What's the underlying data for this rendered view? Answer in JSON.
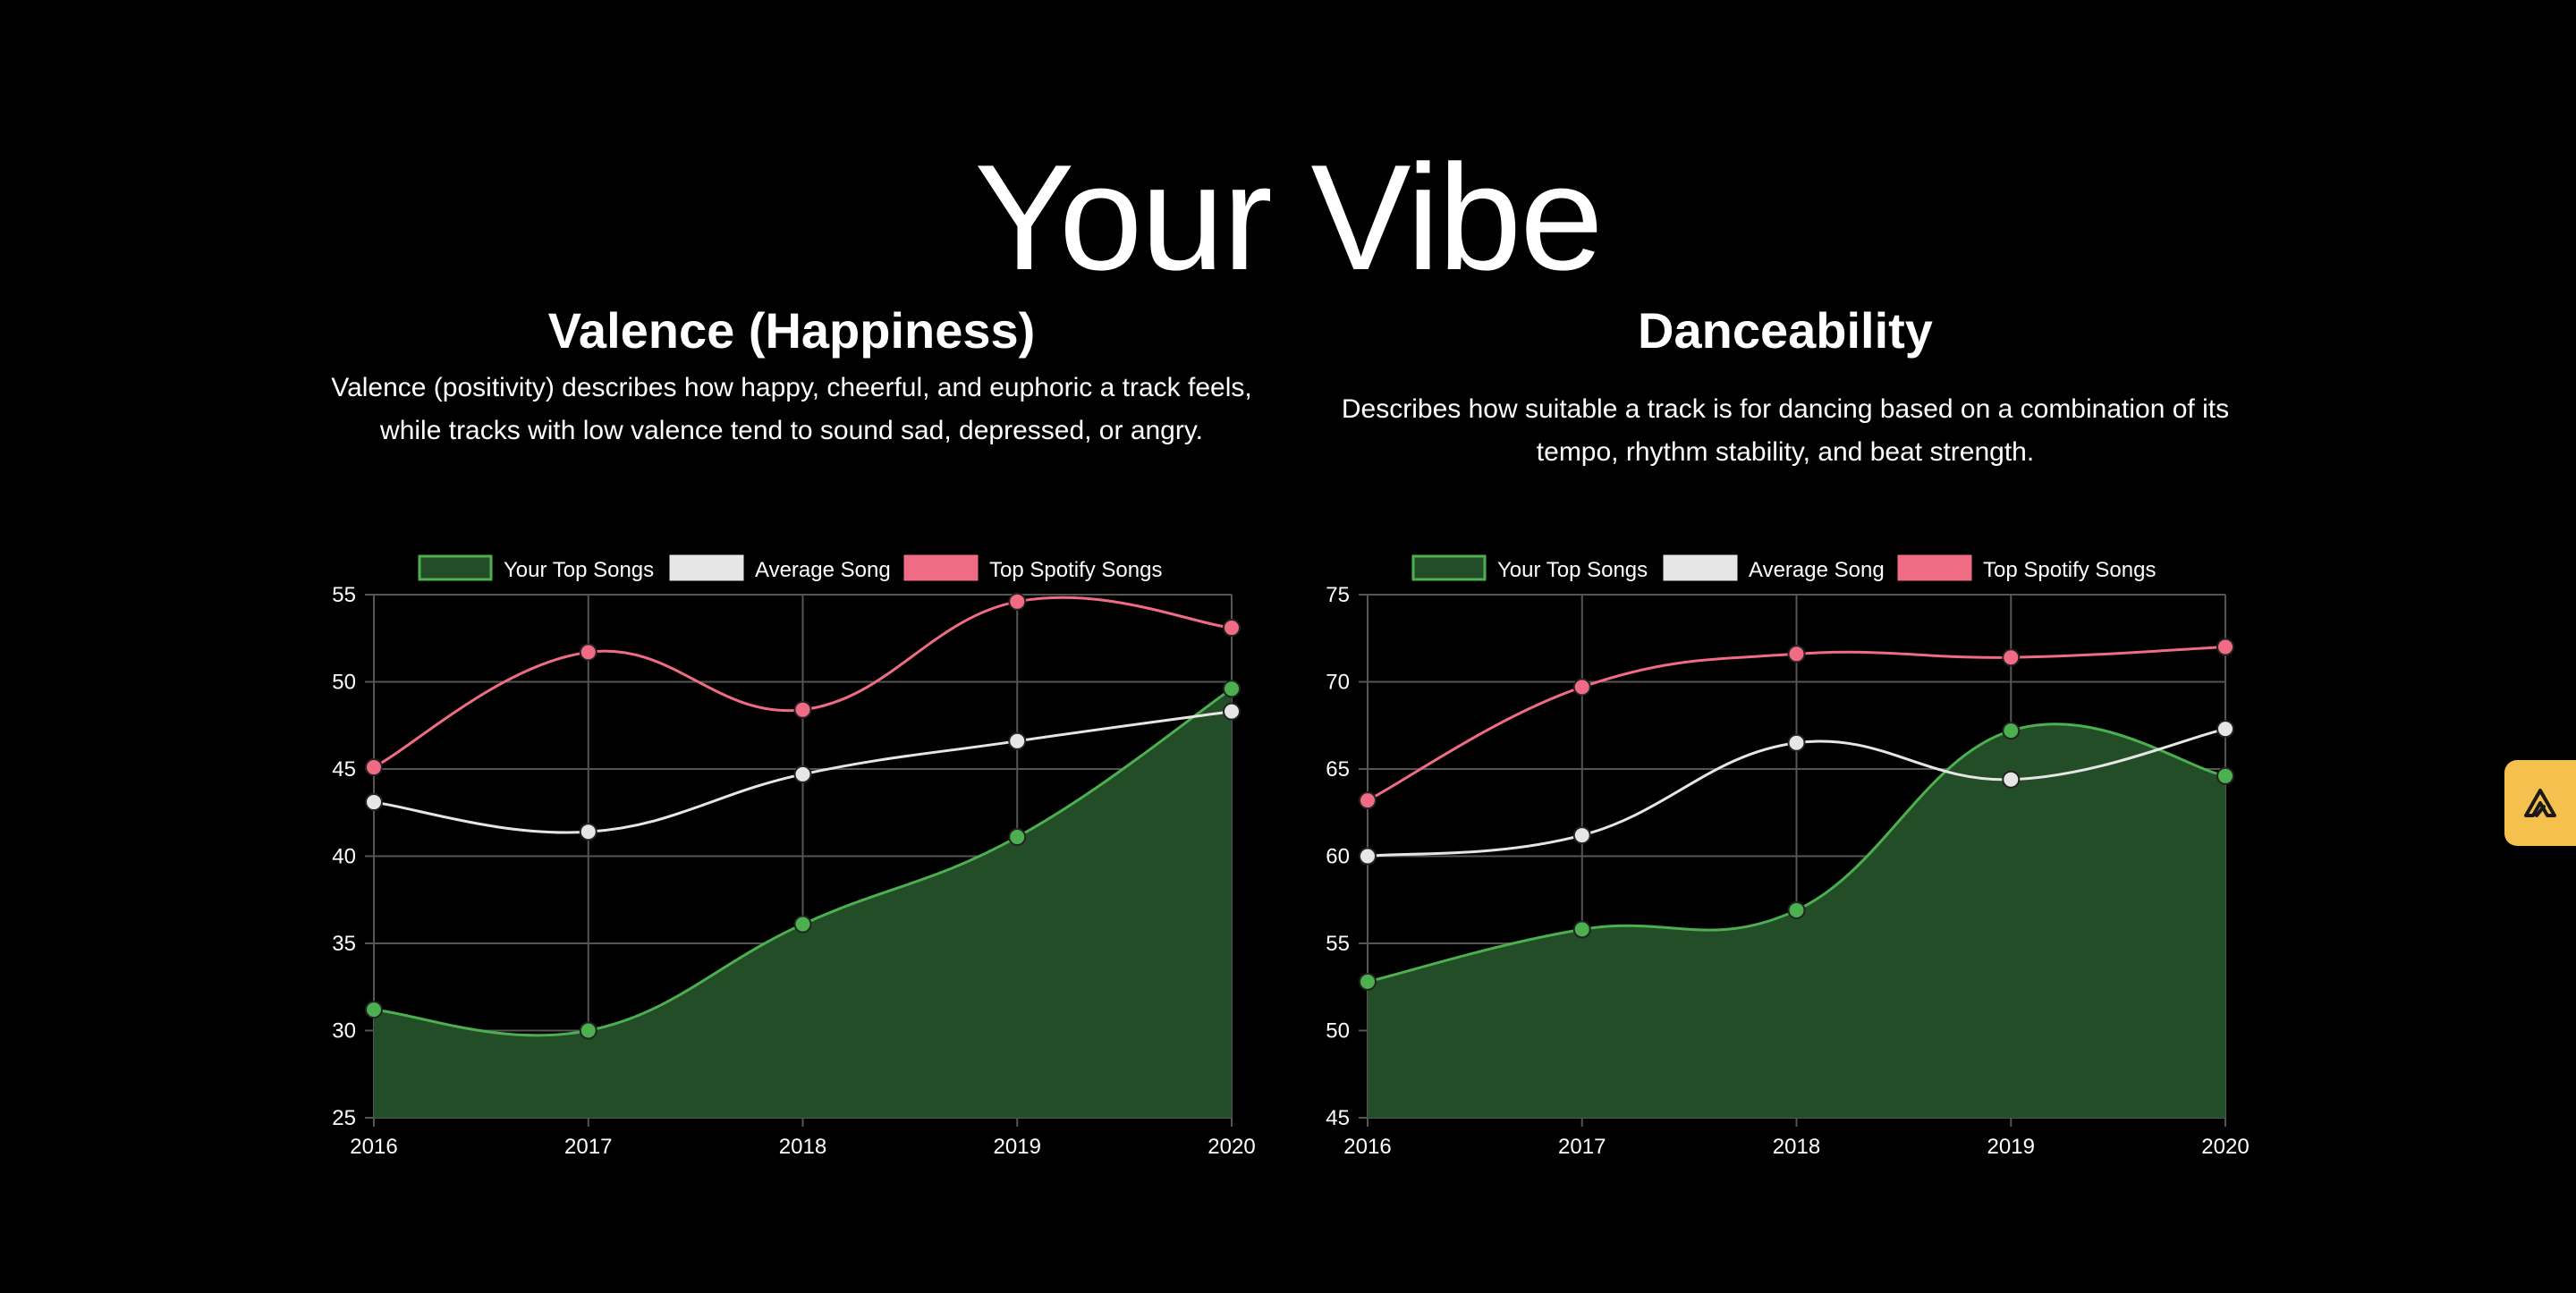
{
  "page_title": "Your Vibe",
  "colors": {
    "your_top_songs": "#4caf50",
    "your_top_songs_fill": "#234d27",
    "average_song": "#e6e6e6",
    "top_spotify_songs": "#f06b84",
    "grid": "#555555",
    "side_tab": "#f5c04e"
  },
  "side_tab_icon": "pennant-logo-icon",
  "panels": [
    {
      "title": "Valence (Happiness)",
      "description": "Valence (positivity) describes how happy, cheerful, and euphoric a track feels, while tracks with low valence tend to sound sad, depressed, or angry."
    },
    {
      "title": "Danceability",
      "description": "Describes how suitable a track is for dancing based on a combination of its tempo, rhythm stability, and beat strength."
    }
  ],
  "chart_data": [
    {
      "type": "line",
      "title": "Valence (Happiness)",
      "x": [
        "2016",
        "2017",
        "2018",
        "2019",
        "2020"
      ],
      "ylim": [
        25,
        55
      ],
      "yticks": [
        25,
        30,
        35,
        40,
        45,
        50,
        55
      ],
      "grid": true,
      "legend": "top-center",
      "series": [
        {
          "name": "Your Top Songs",
          "values": [
            31.2,
            30.0,
            36.1,
            41.1,
            49.6
          ],
          "filled": true
        },
        {
          "name": "Average Song",
          "values": [
            43.1,
            41.4,
            44.7,
            46.6,
            48.3
          ]
        },
        {
          "name": "Top Spotify Songs",
          "values": [
            45.1,
            51.7,
            48.4,
            54.6,
            53.1
          ]
        }
      ]
    },
    {
      "type": "line",
      "title": "Danceability",
      "x": [
        "2016",
        "2017",
        "2018",
        "2019",
        "2020"
      ],
      "ylim": [
        45,
        75
      ],
      "yticks": [
        45,
        50,
        55,
        60,
        65,
        70,
        75
      ],
      "grid": true,
      "legend": "top-center",
      "series": [
        {
          "name": "Your Top Songs",
          "values": [
            52.8,
            55.8,
            56.9,
            67.2,
            64.6
          ],
          "filled": true
        },
        {
          "name": "Average Song",
          "values": [
            60.0,
            61.2,
            66.5,
            64.4,
            67.3
          ]
        },
        {
          "name": "Top Spotify Songs",
          "values": [
            63.2,
            69.7,
            71.6,
            71.4,
            72.0
          ]
        }
      ]
    }
  ]
}
